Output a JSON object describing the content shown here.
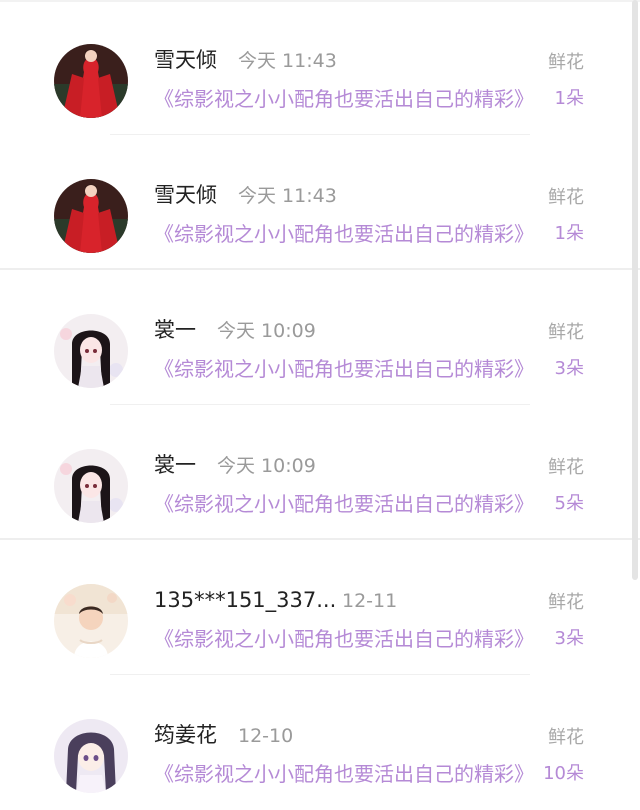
{
  "items": [
    {
      "name": "雪天倾",
      "time": "今天 11:43",
      "type": "鲜花",
      "title": "《综影视之小小配角也要活出自己的精彩》",
      "count": "1朵",
      "avatar": "red-dress-girl-avatar"
    },
    {
      "name": "雪天倾",
      "time": "今天 11:43",
      "type": "鲜花",
      "title": "《综影视之小小配角也要活出自己的精彩》",
      "count": "1朵",
      "avatar": "red-dress-girl-avatar"
    },
    {
      "name": "裳一",
      "time": "今天 10:09",
      "type": "鲜花",
      "title": "《综影视之小小配角也要活出自己的精彩》",
      "count": "3朵",
      "avatar": "anime-girl-avatar"
    },
    {
      "name": "裳一",
      "time": "今天 10:09",
      "type": "鲜花",
      "title": "《综影视之小小配角也要活出自己的精彩》",
      "count": "5朵",
      "avatar": "anime-girl-avatar"
    },
    {
      "name": "135***151_337...",
      "time": "12-11",
      "type": "鲜花",
      "title": "《综影视之小小配角也要活出自己的精彩》",
      "count": "3朵",
      "avatar": "baby-photo-avatar"
    },
    {
      "name": "筠姜花",
      "time": "12-10",
      "type": "鲜花",
      "title": "《综影视之小小配角也要活出自己的精彩》",
      "count": "10朵",
      "avatar": "anime-purple-hair-avatar"
    }
  ],
  "colors": {
    "accent_purple": "#b58ad6",
    "name_text": "#222222",
    "secondary_text": "#9a9a9a"
  }
}
